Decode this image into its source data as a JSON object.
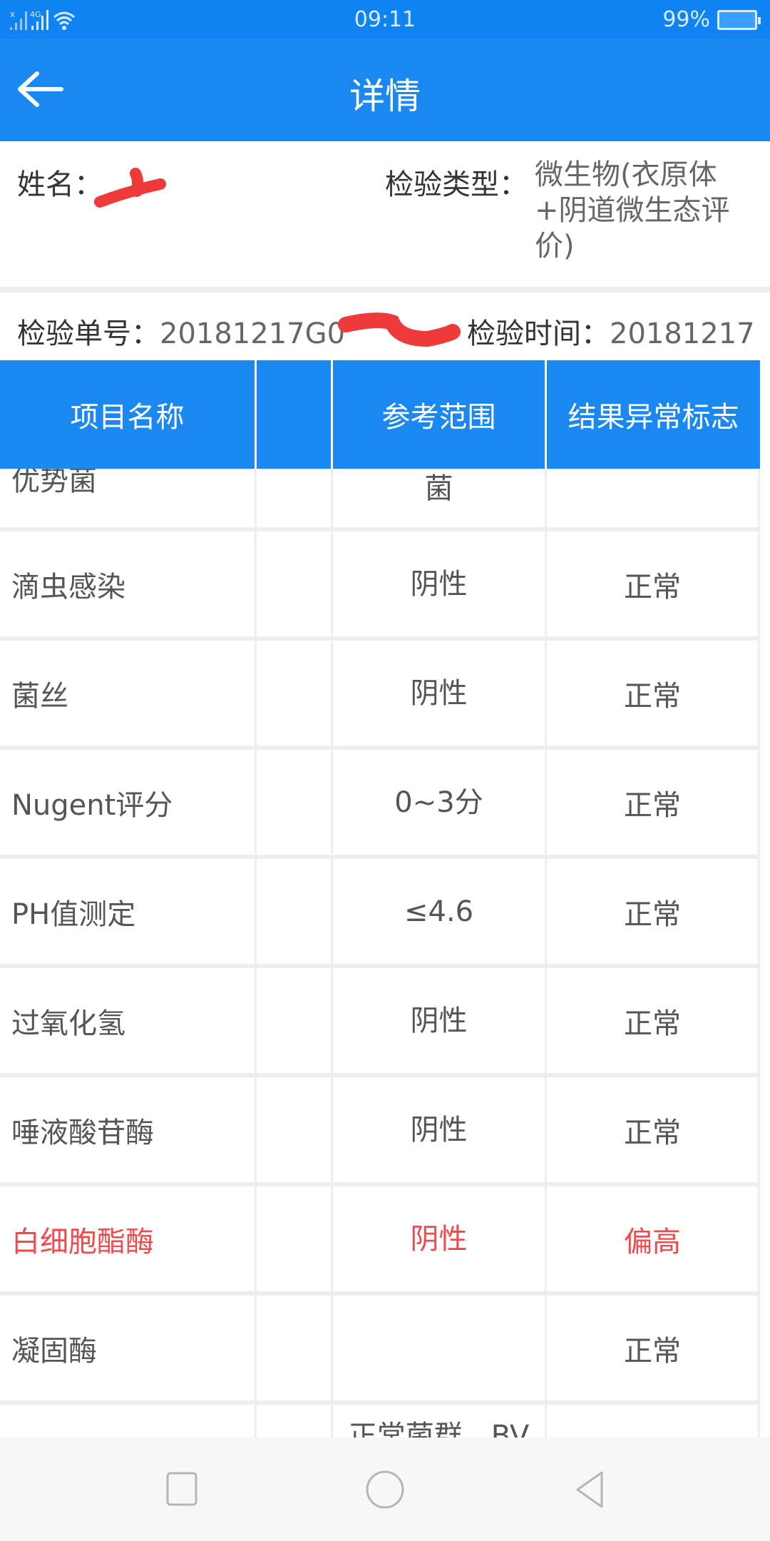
{
  "status_bar": {
    "time": "09:11",
    "battery": "99%",
    "network": "4G"
  },
  "app_bar": {
    "title": "详情"
  },
  "info": {
    "name_label": "姓名：",
    "type_label": "检验类型：",
    "type_value": "微生物(衣原体+阴道微生态评价)",
    "order_label": "检验单号：",
    "order_value": "20181217G0",
    "time_label": "检验时间：",
    "time_value": "20181217"
  },
  "table": {
    "headers": [
      "项目名称",
      "",
      "参考范围",
      "结果异常标志"
    ],
    "rows": [
      {
        "name": "优势菌",
        "ref": "菌",
        "flag": "",
        "abnormal": false
      },
      {
        "name": "滴虫感染",
        "ref": "阴性",
        "flag": "正常",
        "abnormal": false
      },
      {
        "name": "菌丝",
        "ref": "阴性",
        "flag": "正常",
        "abnormal": false
      },
      {
        "name": "Nugent评分",
        "ref": "0~3分",
        "flag": "正常",
        "abnormal": false
      },
      {
        "name": "PH值测定",
        "ref": "≤4.6",
        "flag": "正常",
        "abnormal": false
      },
      {
        "name": "过氧化氢",
        "ref": "阴性",
        "flag": "正常",
        "abnormal": false
      },
      {
        "name": "唾液酸苷酶",
        "ref": "阴性",
        "flag": "正常",
        "abnormal": false
      },
      {
        "name": "白细胞酯酶",
        "ref": "阴性",
        "flag": "偏高",
        "abnormal": true
      },
      {
        "name": "凝固酶",
        "ref": "",
        "flag": "正常",
        "abnormal": false
      },
      {
        "name": "",
        "ref": "正常菌群，BV",
        "flag": "",
        "abnormal": false
      }
    ]
  },
  "colors": {
    "primary": "#1a88f0",
    "abnormal": "#f04a4a",
    "redaction": "#ee3a3a"
  }
}
